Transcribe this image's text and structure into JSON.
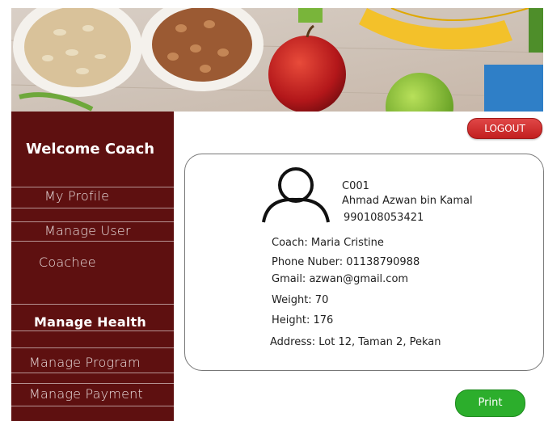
{
  "sidebar": {
    "title": "Welcome Coach",
    "items": [
      "My Profile",
      "Manage User",
      "Coachee",
      "Manage Health",
      "Manage Program",
      "Manage Payment"
    ]
  },
  "header": {
    "logout_label": "LOGOUT"
  },
  "profile": {
    "id": "C001",
    "name": "Ahmad Azwan  bin Kamal",
    "ic": "990108053421",
    "coach": "Coach: Maria Cristine",
    "phone": "Phone Nuber: 01138790988",
    "gmail": "Gmail: azwan@gmail.com",
    "weight": "Weight: 70",
    "height": "Height: 176",
    "address": "Address: Lot 12, Taman 2, Pekan"
  },
  "actions": {
    "print_label": "Print"
  },
  "colors": {
    "sidebar": "#5e1010",
    "logout": "#d12f2f",
    "print": "#2cae2c"
  }
}
